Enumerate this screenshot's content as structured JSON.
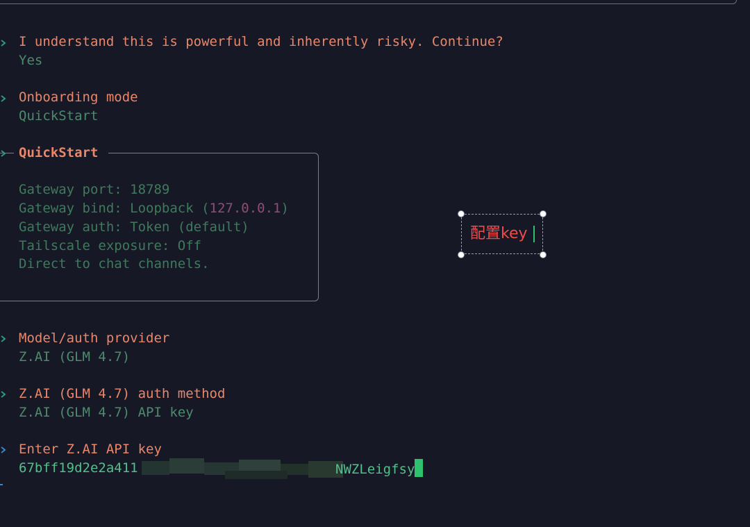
{
  "colors": {
    "background": "#161826",
    "question": "#e9876b",
    "answer": "#4c8b6c",
    "answer_bright": "#53c08a",
    "chevron_done": "#2d9a7c",
    "chevron_active": "#3a86c8",
    "annotation_text": "#f04a4a",
    "cursor": "#2ec26f"
  },
  "prompts": [
    {
      "icon": "chevron-right-icon",
      "question": "I understand this is powerful and inherently risky. Continue?",
      "answer": "Yes"
    },
    {
      "icon": "chevron-right-icon",
      "question": "Onboarding mode",
      "answer": "QuickStart"
    }
  ],
  "quickstart": {
    "icon": "chevron-right-icon",
    "title": "QuickStart",
    "port_line": "Gateway port: 18789",
    "bind_prefix": "Gateway bind: Loopback (",
    "bind_ip": "127.0.0.1",
    "bind_suffix": ")",
    "auth_line": "Gateway auth: Token (default)",
    "tailscale_line": "Tailscale exposure: Off",
    "direct_line": "Direct to chat channels."
  },
  "prompts_after": [
    {
      "icon": "chevron-right-icon",
      "question": "Model/auth provider",
      "answer": "Z.AI (GLM 4.7)"
    },
    {
      "icon": "chevron-right-icon",
      "question": "Z.AI (GLM 4.7) auth method",
      "answer": "Z.AI (GLM 4.7) API key"
    }
  ],
  "api_key_prompt": {
    "icon": "chevron-right-icon",
    "question": "Enter Z.AI API key",
    "value_start": "67bff19d2e2a411",
    "value_end": "NWZLeigfsy"
  },
  "annotation": {
    "text": "配置key"
  }
}
